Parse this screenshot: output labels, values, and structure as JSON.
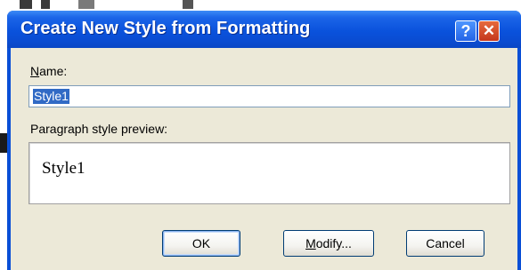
{
  "dialog": {
    "title": "Create New Style from Formatting",
    "help_glyph": "?",
    "close_glyph": "✕",
    "name_label_accel": "N",
    "name_label_rest": "ame:",
    "name_value": "Style1",
    "preview_label": "Paragraph style preview:",
    "preview_text": "Style1",
    "ok_label": "OK",
    "modify_label_accel": "M",
    "modify_label_rest": "odify...",
    "cancel_label": "Cancel"
  },
  "colors": {
    "titlebar": "#0a52dc",
    "client_bg": "#ece9d8",
    "selection": "#316ac5",
    "close_button": "#c4361c"
  },
  "icons": [
    "help-icon",
    "close-icon"
  ]
}
